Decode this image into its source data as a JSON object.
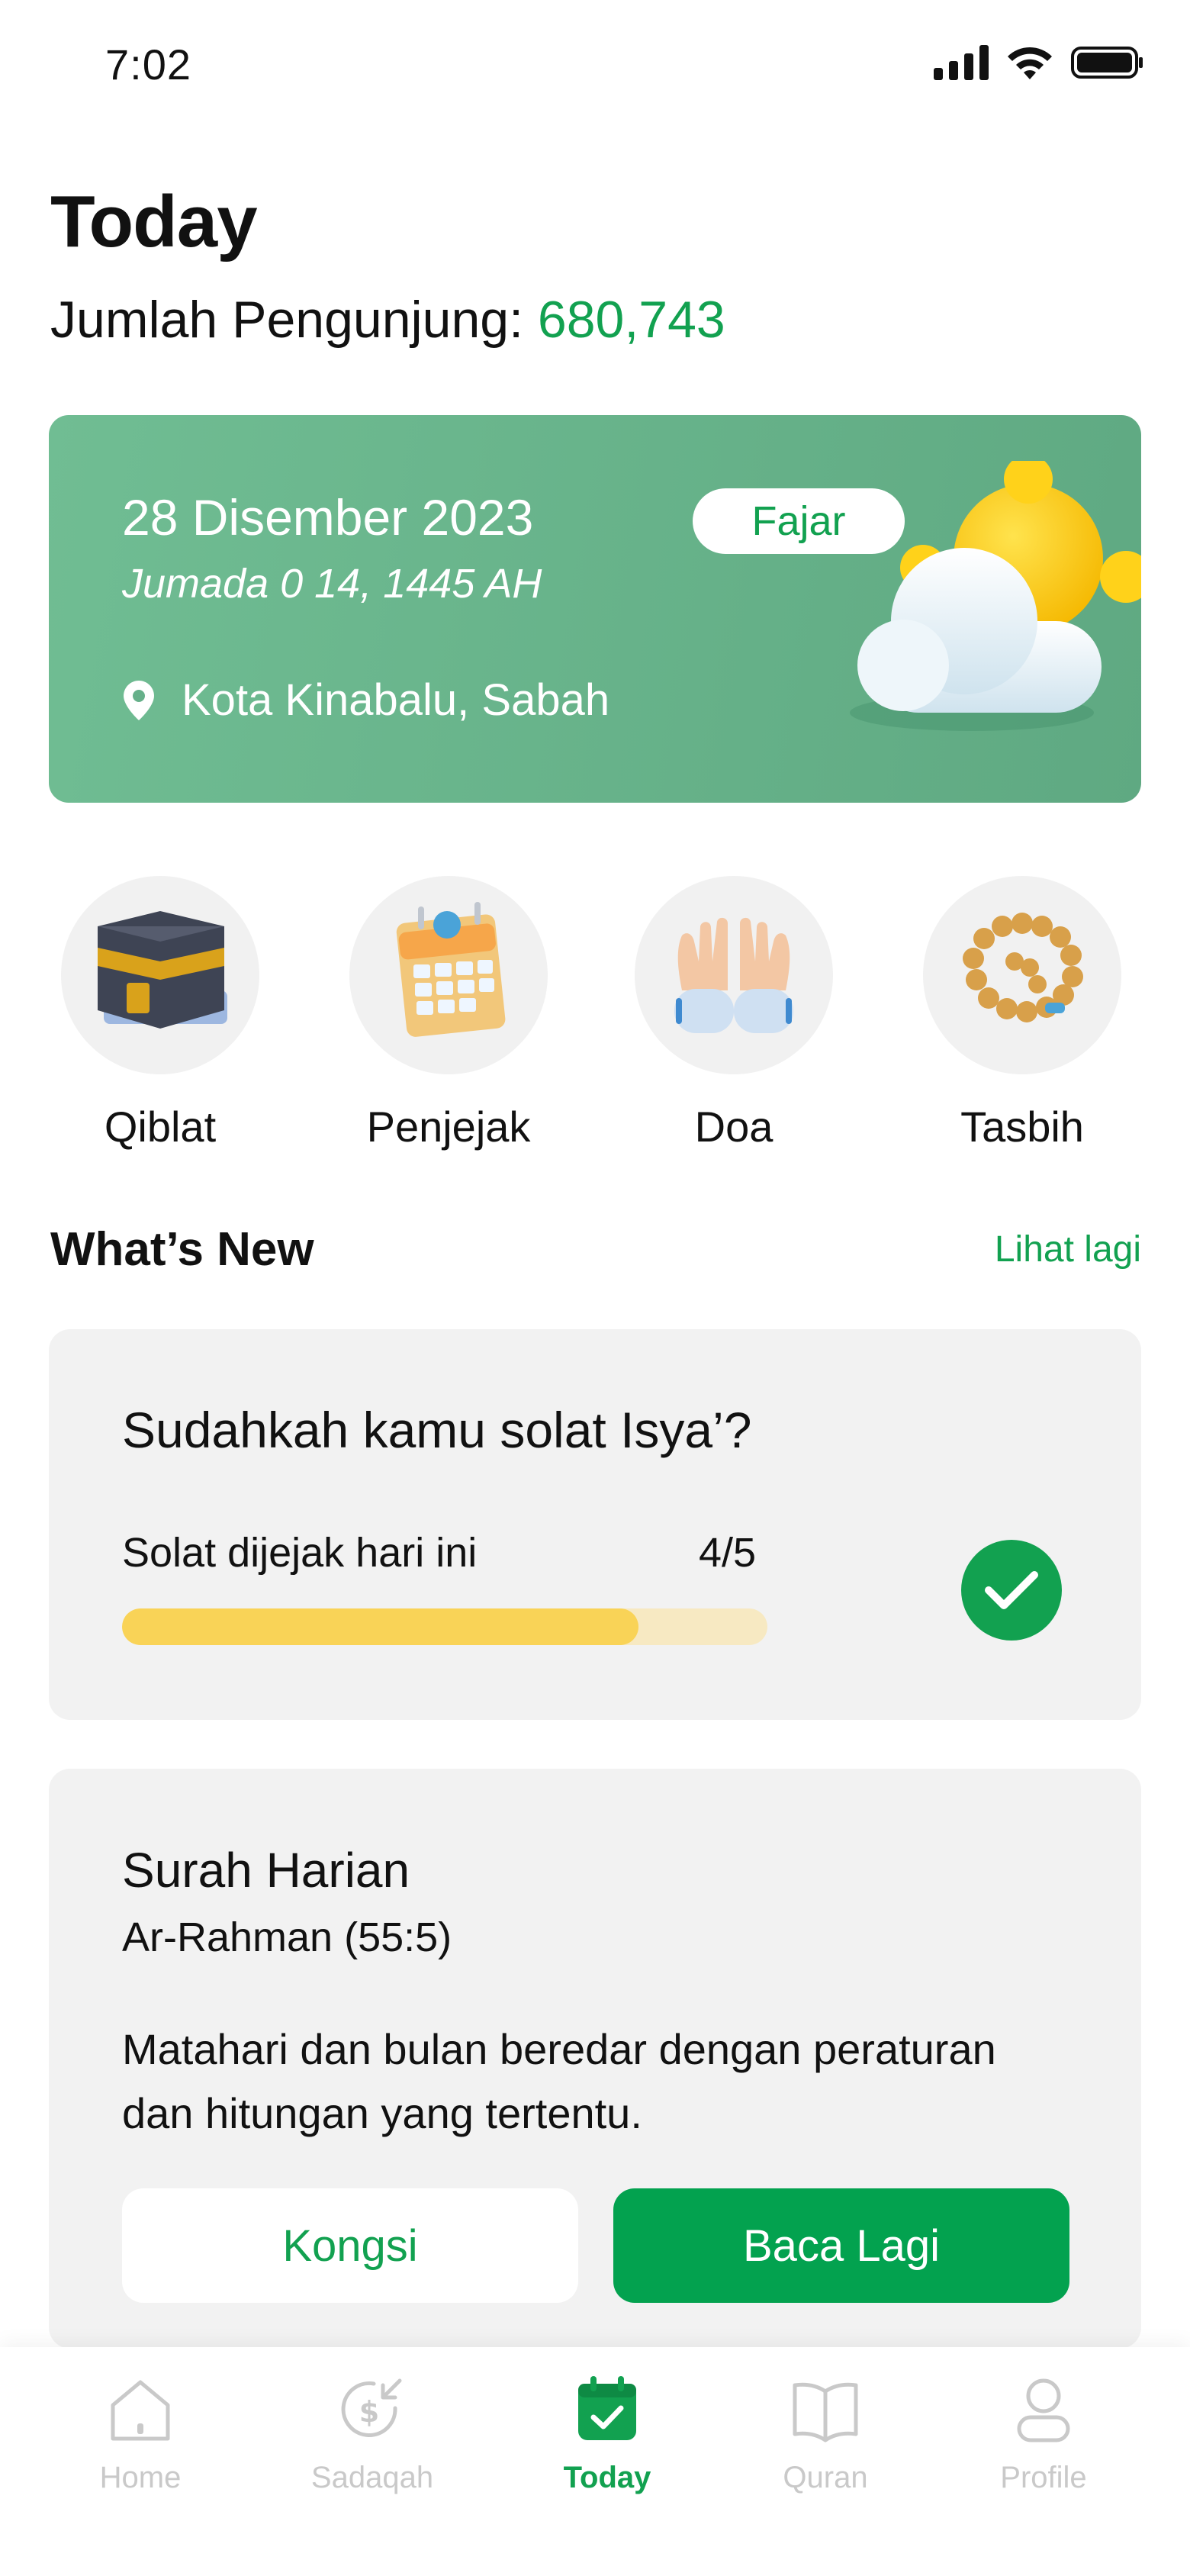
{
  "status_bar": {
    "time": "7:02"
  },
  "header": {
    "title": "Today",
    "visitor_label": "Jumlah Pengunjung:",
    "visitor_count": "680,743"
  },
  "date_card": {
    "gregorian_date": "28 Disember 2023",
    "hijri_date": "Jumada 0 14, 1445 AH",
    "location": "Kota Kinabalu, Sabah",
    "prayer": "Fajar"
  },
  "shortcuts": [
    {
      "label": "Qiblat",
      "icon": "kaaba-icon"
    },
    {
      "label": "Penjejak",
      "icon": "calendar-icon"
    },
    {
      "label": "Doa",
      "icon": "praying-hands-icon"
    },
    {
      "label": "Tasbih",
      "icon": "prayer-beads-icon"
    }
  ],
  "whats_new": {
    "title": "What’s New",
    "see_more": "Lihat lagi"
  },
  "solat_card": {
    "question": "Sudahkah kamu solat Isya’?",
    "tracked_label": "Solat dijejak hari ini",
    "count_text": "4/5",
    "progress": 0.8
  },
  "surah_card": {
    "title": "Surah Harian",
    "reference": "Ar-Rahman (55:5)",
    "verse": "Matahari dan bulan beredar dengan peraturan dan hitungan yang tertentu.",
    "share_label": "Kongsi",
    "read_label": "Baca Lagi"
  },
  "tabbar": {
    "items": [
      {
        "label": "Home",
        "icon": "home-icon"
      },
      {
        "label": "Sadaqah",
        "icon": "donation-icon"
      },
      {
        "label": "Today",
        "icon": "calendar-check-icon",
        "active": true
      },
      {
        "label": "Quran",
        "icon": "book-icon"
      },
      {
        "label": "Profile",
        "icon": "user-icon"
      }
    ]
  },
  "colors": {
    "brand_green": "#12a150",
    "card_green": "#6ab48c",
    "progress_fill": "#f9d357",
    "progress_track": "#f7e9c2"
  }
}
